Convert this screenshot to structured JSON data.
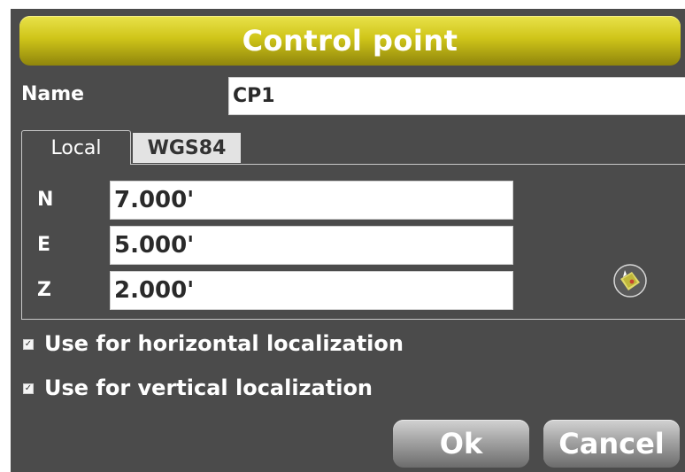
{
  "dialog": {
    "title": "Control point"
  },
  "name_field": {
    "label": "Name",
    "value": "CP1"
  },
  "tabs": [
    {
      "label": "Local",
      "active": true
    },
    {
      "label": "WGS84",
      "active": false
    }
  ],
  "coords": {
    "n": {
      "label": "N",
      "value": "7.000'"
    },
    "e": {
      "label": "E",
      "value": "5.000'"
    },
    "z": {
      "label": "Z",
      "value": "2.000'"
    }
  },
  "checkboxes": [
    {
      "label": "Use for horizontal localization",
      "checked": true
    },
    {
      "label": "Use for vertical localization",
      "checked": true
    }
  ],
  "buttons": {
    "ok": "Ok",
    "cancel": "Cancel"
  },
  "icons": {
    "measure": "point-measure-icon"
  },
  "colors": {
    "title_bar": "#cfc519",
    "dialog_bg": "#4b4b4b",
    "button": "#a3a3a3"
  }
}
